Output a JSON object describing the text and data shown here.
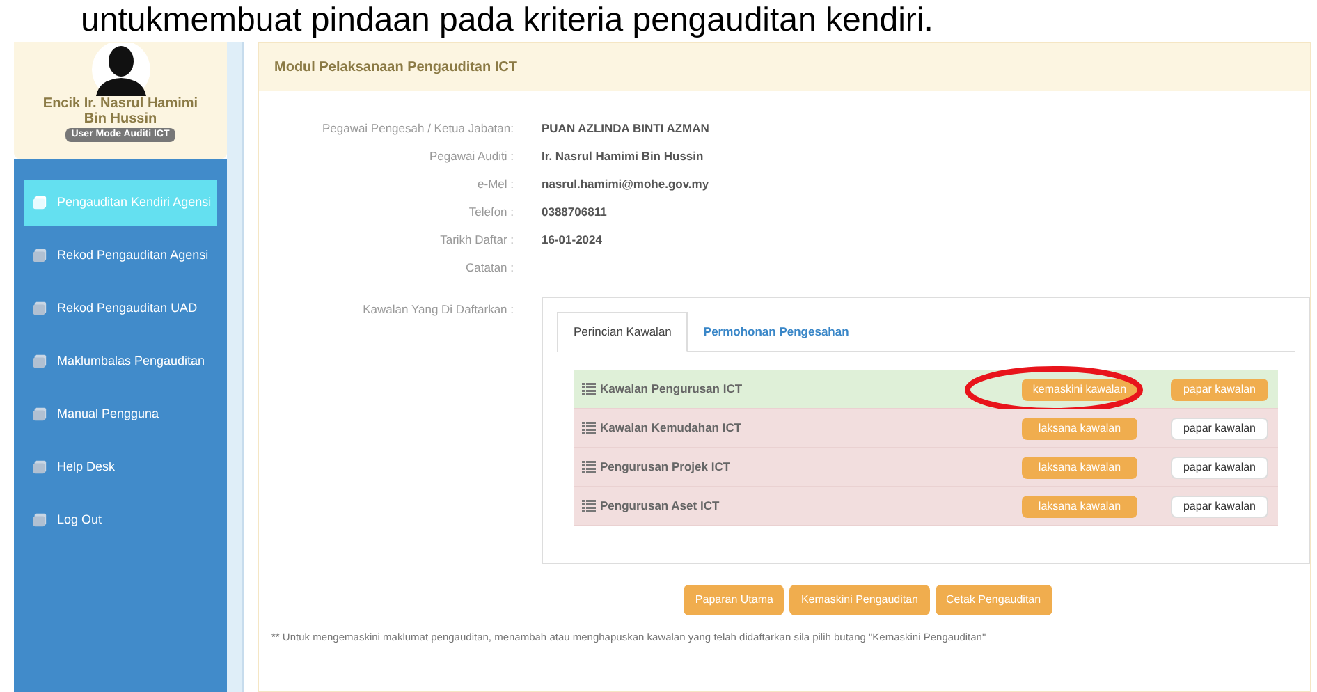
{
  "caption": "untukmembuat pindaan pada kriteria pengauditan kendiri.",
  "profile": {
    "name": "Encik Ir. Nasrul Hamimi Bin Hussin",
    "role_badge": "User Mode Auditi ICT"
  },
  "sidebar": {
    "items": [
      {
        "label": "Pengauditan Kendiri Agensi",
        "selected": true
      },
      {
        "label": "Rekod Pengauditan Agensi",
        "selected": false
      },
      {
        "label": "Rekod Pengauditan UAD",
        "selected": false
      },
      {
        "label": "Maklumbalas Pengauditan",
        "selected": false
      },
      {
        "label": "Manual Pengguna",
        "selected": false
      },
      {
        "label": "Help Desk",
        "selected": false
      },
      {
        "label": "Log Out",
        "selected": false
      }
    ]
  },
  "panel": {
    "title": "Modul Pelaksanaan Pengauditan ICT",
    "fields": [
      {
        "label": "Pegawai Pengesah / Ketua Jabatan:",
        "value": "PUAN AZLINDA BINTI AZMAN"
      },
      {
        "label": "Pegawai Auditi :",
        "value": "Ir. Nasrul Hamimi Bin Hussin"
      },
      {
        "label": "e-Mel :",
        "value": "nasrul.hamimi@mohe.gov.my"
      },
      {
        "label": "Telefon :",
        "value": "0388706811"
      },
      {
        "label": "Tarikh Daftar :",
        "value": "16-01-2024"
      },
      {
        "label": "Catatan :"
      }
    ],
    "controls_label": "Kawalan Yang Di Daftarkan :",
    "tabs": [
      {
        "label": "Perincian Kawalan",
        "selected": true
      },
      {
        "label": "Permohonan Pengesahan",
        "selected": false
      }
    ],
    "controls": [
      {
        "name": "Kawalan Pengurusan ICT",
        "completed": true,
        "action": "kemaskini kawalan",
        "view": "papar kawalan",
        "circled": true
      },
      {
        "name": "Kawalan Kemudahan ICT",
        "completed": false,
        "action": "laksana kawalan",
        "view": "papar kawalan",
        "circled": false
      },
      {
        "name": "Pengurusan Projek ICT",
        "completed": false,
        "action": "laksana kawalan",
        "view": "papar kawalan",
        "circled": false
      },
      {
        "name": "Pengurusan Aset ICT",
        "completed": false,
        "action": "laksana kawalan",
        "view": "papar kawalan",
        "circled": false
      }
    ],
    "buttons": [
      "Paparan Utama",
      "Kemaskini Pengauditan",
      "Cetak Pengauditan"
    ],
    "note": "** Untuk mengemaskini maklumat pengauditan, menambah atau menghapuskan kawalan yang telah didaftarkan sila pilih butang \"Kemaskini Pengauditan\""
  }
}
